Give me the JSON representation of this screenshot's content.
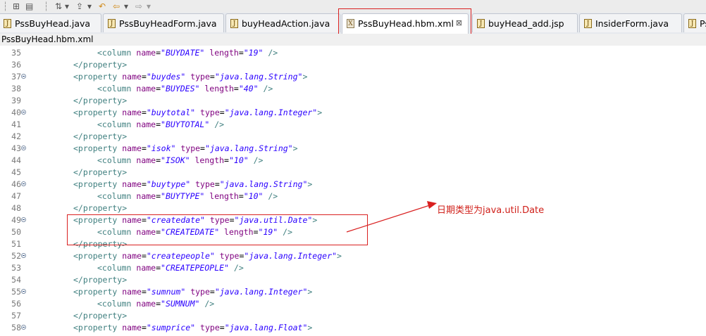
{
  "tabs": [
    {
      "label": "PssBuyHead.java",
      "icon": "J",
      "active": false
    },
    {
      "label": "PssBuyHeadForm.java",
      "icon": "J",
      "active": false
    },
    {
      "label": "buyHeadAction.java",
      "icon": "J",
      "active": false
    },
    {
      "label": "PssBuyHead.hbm.xml",
      "icon": "X",
      "active": true
    },
    {
      "label": "buyHead_add.jsp",
      "icon": "J",
      "active": false
    },
    {
      "label": "InsiderForm.java",
      "icon": "J",
      "active": false
    },
    {
      "label": "Ps",
      "icon": "J",
      "active": false
    }
  ],
  "tab_close_symbol": "⊠",
  "file_title": "PssBuyHead.hbm.xml",
  "annotation": "日期类型为java.util.Date",
  "code_lines": [
    {
      "n": "35",
      "fold": false,
      "indent": 2,
      "kind": "column",
      "name": "BUYDATE",
      "length": "19"
    },
    {
      "n": "36",
      "fold": false,
      "indent": 1,
      "kind": "close"
    },
    {
      "n": "37",
      "fold": true,
      "indent": 1,
      "kind": "property",
      "name": "buydes",
      "type": "java.lang.String"
    },
    {
      "n": "38",
      "fold": false,
      "indent": 2,
      "kind": "column",
      "name": "BUYDES",
      "length": "40"
    },
    {
      "n": "39",
      "fold": false,
      "indent": 1,
      "kind": "close"
    },
    {
      "n": "40",
      "fold": true,
      "indent": 1,
      "kind": "property",
      "name": "buytotal",
      "type": "java.lang.Integer"
    },
    {
      "n": "41",
      "fold": false,
      "indent": 2,
      "kind": "column",
      "name": "BUYTOTAL"
    },
    {
      "n": "42",
      "fold": false,
      "indent": 1,
      "kind": "close"
    },
    {
      "n": "43",
      "fold": true,
      "indent": 1,
      "kind": "property",
      "name": "isok",
      "type": "java.lang.String"
    },
    {
      "n": "44",
      "fold": false,
      "indent": 2,
      "kind": "column",
      "name": "ISOK",
      "length": "10"
    },
    {
      "n": "45",
      "fold": false,
      "indent": 1,
      "kind": "close"
    },
    {
      "n": "46",
      "fold": true,
      "indent": 1,
      "kind": "property",
      "name": "buytype",
      "type": "java.lang.String"
    },
    {
      "n": "47",
      "fold": false,
      "indent": 2,
      "kind": "column",
      "name": "BUYTYPE",
      "length": "10"
    },
    {
      "n": "48",
      "fold": false,
      "indent": 1,
      "kind": "close"
    },
    {
      "n": "49",
      "fold": true,
      "indent": 1,
      "kind": "property",
      "name": "createdate",
      "type": "java.util.Date"
    },
    {
      "n": "50",
      "fold": false,
      "indent": 2,
      "kind": "column",
      "name": "CREATEDATE",
      "length": "19"
    },
    {
      "n": "51",
      "fold": false,
      "indent": 1,
      "kind": "close"
    },
    {
      "n": "52",
      "fold": true,
      "indent": 1,
      "kind": "property",
      "name": "createpeople",
      "type": "java.lang.Integer"
    },
    {
      "n": "53",
      "fold": false,
      "indent": 2,
      "kind": "column",
      "name": "CREATEPEOPLE"
    },
    {
      "n": "54",
      "fold": false,
      "indent": 1,
      "kind": "close"
    },
    {
      "n": "55",
      "fold": true,
      "indent": 1,
      "kind": "property",
      "name": "sumnum",
      "type": "java.lang.Integer"
    },
    {
      "n": "56",
      "fold": false,
      "indent": 2,
      "kind": "column",
      "name": "SUMNUM"
    },
    {
      "n": "57",
      "fold": false,
      "indent": 1,
      "kind": "close"
    },
    {
      "n": "58",
      "fold": true,
      "indent": 1,
      "kind": "property",
      "name": "sumprice",
      "type": "java.lang.Float"
    }
  ],
  "colors": {
    "tag": "#3f7f7f",
    "attr": "#7f007f",
    "value": "#2a00ff",
    "highlight": "#d92020"
  }
}
